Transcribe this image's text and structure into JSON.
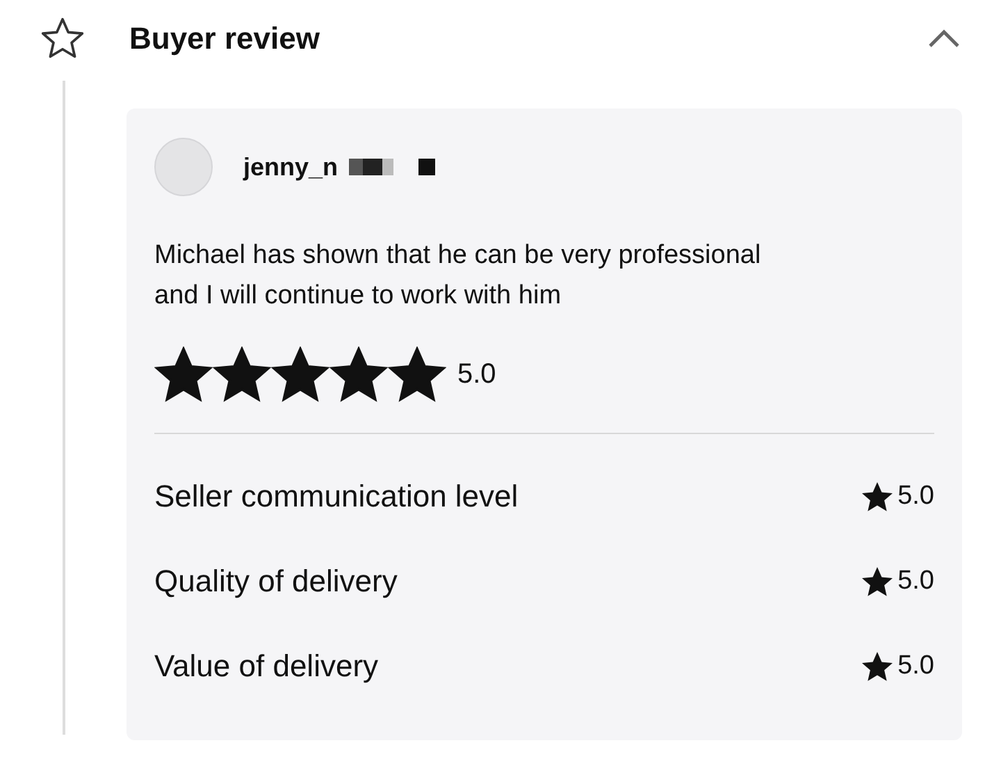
{
  "section": {
    "title": "Buyer review",
    "expanded": true
  },
  "review": {
    "username": "jenny_n",
    "text": "Michael has shown that he can be very professional and I will continue to work with him",
    "stars": 5,
    "rating": "5.0",
    "criteria": [
      {
        "label": "Seller communication level",
        "rating": "5.0"
      },
      {
        "label": "Quality of delivery",
        "rating": "5.0"
      },
      {
        "label": "Value of delivery",
        "rating": "5.0"
      }
    ]
  }
}
